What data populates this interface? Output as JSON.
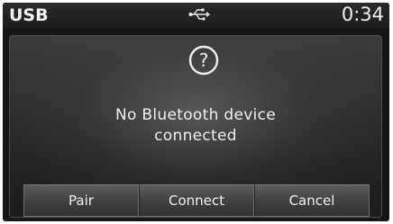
{
  "status_bar": {
    "mode_label": "USB",
    "connection_icon": "usb-icon",
    "clock": "0:34"
  },
  "dialog": {
    "icon": "question-icon",
    "icon_glyph": "?",
    "message_line1": "No Bluetooth device",
    "message_line2": "connected",
    "buttons": {
      "pair_label": "Pair",
      "connect_label": "Connect",
      "cancel_label": "Cancel"
    }
  },
  "colors": {
    "screen_background": "#161616",
    "text": "#f0f0f0",
    "button_face": "#4a4a4a"
  }
}
